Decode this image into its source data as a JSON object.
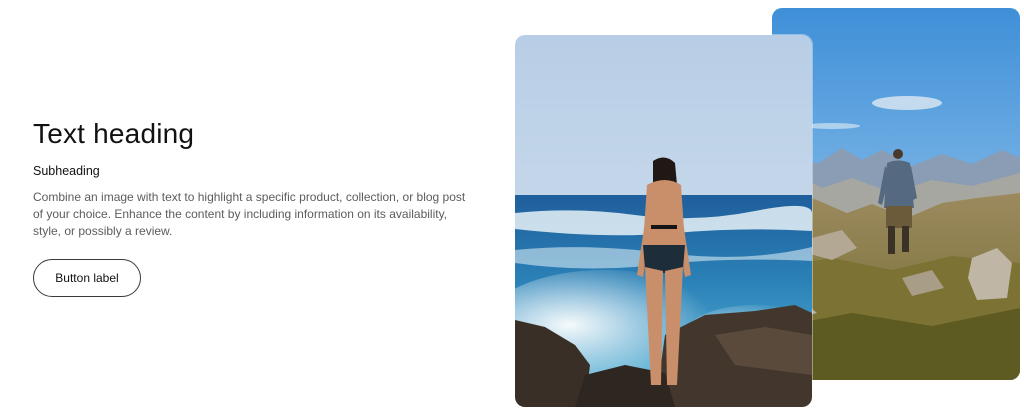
{
  "content": {
    "heading": "Text heading",
    "subheading": "Subheading",
    "body": "Combine an image with text to highlight a specific product, collection, or blog post of your choice. Enhance the content by including information on its availability, style, or possibly a review.",
    "button_label": "Button label"
  },
  "images": {
    "front": {
      "subject": "woman standing on rocks facing ocean waves"
    },
    "back": {
      "subject": "hiker walking on rocky mountain trail"
    }
  }
}
